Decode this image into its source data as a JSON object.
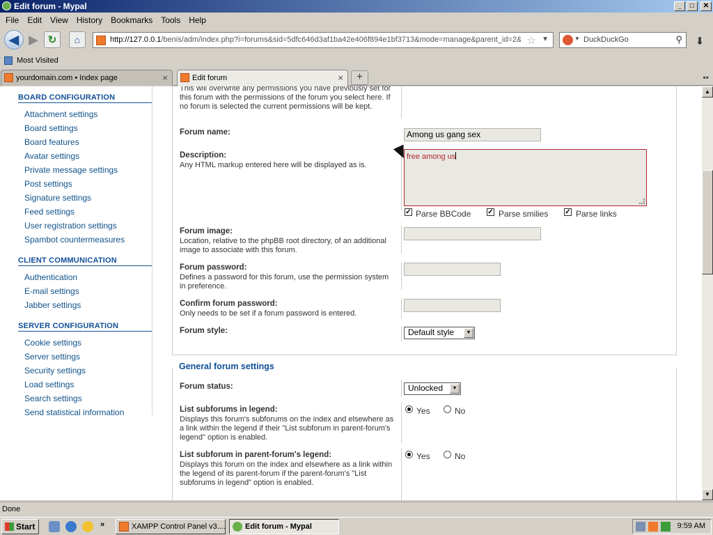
{
  "window": {
    "title": "Edit forum - Mypal",
    "buttons": {
      "minimize": "_",
      "maximize": "□",
      "close": "✕"
    }
  },
  "menu": [
    "File",
    "Edit",
    "View",
    "History",
    "Bookmarks",
    "Tools",
    "Help"
  ],
  "nav": {
    "url_host": "http://127.0.0.1",
    "url_path": "/benis/adm/index.php?i=forums&sid=5dfc646d3af1ba42e406f894e1bf3713&mode=manage&parent_id=2&",
    "search_engine": "DuckDuckGo",
    "icons": {
      "back": "back-arrow-icon",
      "forward": "forward-arrow-icon",
      "reload": "reload-icon",
      "home": "home-icon",
      "star": "bookmark-star-icon",
      "search": "magnifier-icon",
      "download": "download-arrow-icon"
    }
  },
  "bookmarks": {
    "label": "Most Visited"
  },
  "tabs": [
    {
      "label": "yourdomain.com • Index page",
      "active": false
    },
    {
      "label": "Edit forum",
      "active": true
    }
  ],
  "sidebar": {
    "sections": [
      {
        "title": "BOARD CONFIGURATION",
        "items": [
          "Attachment settings",
          "Board settings",
          "Board features",
          "Avatar settings",
          "Private message settings",
          "Post settings",
          "Signature settings",
          "Feed settings",
          "User registration settings",
          "Spambot countermeasures"
        ]
      },
      {
        "title": "CLIENT COMMUNICATION",
        "items": [
          "Authentication",
          "E-mail settings",
          "Jabber settings"
        ]
      },
      {
        "title": "SERVER CONFIGURATION",
        "items": [
          "Cookie settings",
          "Server settings",
          "Security settings",
          "Load settings",
          "Search settings",
          "Send statistical information"
        ]
      }
    ]
  },
  "form": {
    "copy_permissions_note": "This will overwrite any permissions you have previously set for this forum with the permissions of the forum you select here. If no forum is selected the current permissions will be kept.",
    "forum_name": {
      "label": "Forum name:",
      "value": "Among us gang sex"
    },
    "description": {
      "label": "Description:",
      "hint": "Any HTML markup entered here will be displayed as is.",
      "value": "free among us",
      "options": [
        {
          "label": "Parse BBCode",
          "checked": true
        },
        {
          "label": "Parse smilies",
          "checked": true
        },
        {
          "label": "Parse links",
          "checked": true
        }
      ]
    },
    "forum_image": {
      "label": "Forum image:",
      "hint": "Location, relative to the phpBB root directory, of an additional image to associate with this forum.",
      "value": ""
    },
    "forum_password": {
      "label": "Forum password:",
      "hint": "Defines a password for this forum, use the permission system in preference.",
      "value": ""
    },
    "confirm_password": {
      "label": "Confirm forum password:",
      "hint": "Only needs to be set if a forum password is entered.",
      "value": ""
    },
    "forum_style": {
      "label": "Forum style:",
      "value": "Default style"
    }
  },
  "general": {
    "legend": "General forum settings",
    "forum_status": {
      "label": "Forum status:",
      "value": "Unlocked"
    },
    "list_subforums": {
      "label": "List subforums in legend:",
      "hint": "Displays this forum's subforums on the index and elsewhere as a link within the legend if their \"List subforum in parent-forum's legend\" option is enabled.",
      "yes": "Yes",
      "no": "No",
      "selected": "Yes"
    },
    "list_in_parent": {
      "label": "List subforum in parent-forum's legend:",
      "hint": "Displays this forum on the index and elsewhere as a link within the legend of its parent-forum if the parent-forum's \"List subforums in legend\" option is enabled.",
      "yes": "Yes",
      "no": "No",
      "selected": "Yes"
    }
  },
  "status": {
    "text": "Done"
  },
  "taskbar": {
    "start": "Start",
    "tasks": [
      "XAMPP Control Panel v3....",
      "Edit forum - Mypal"
    ],
    "clock": "9:59 AM"
  }
}
